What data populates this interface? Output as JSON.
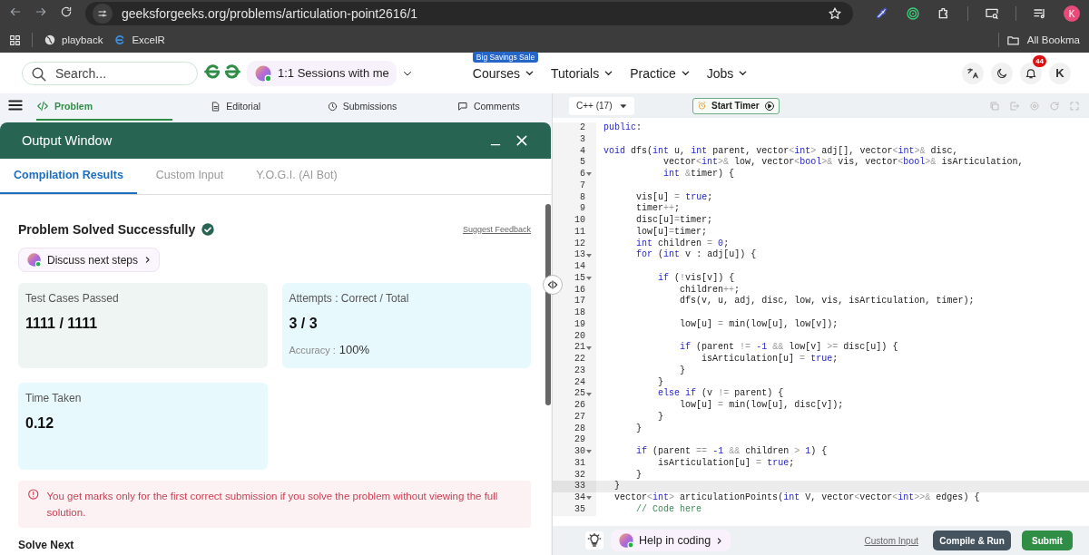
{
  "browser": {
    "url": "geeksforgeeks.org/problems/articulation-point2616/1",
    "profile": "K",
    "bookmarks": [
      "playback",
      "ExcelR"
    ],
    "all_bookmarks": "All Bookma"
  },
  "header": {
    "search": {
      "placeholder": "Search..."
    },
    "sessions": "1:1 Sessions with me",
    "sale_badge": "Big Savings Sale",
    "nav": [
      "Courses",
      "Tutorials",
      "Practice",
      "Jobs"
    ],
    "notifications": "44",
    "avatar": "K"
  },
  "problem_tabs": [
    {
      "label": "Problem",
      "selected": true
    },
    {
      "label": "Editorial",
      "selected": false
    },
    {
      "label": "Submissions",
      "selected": false
    },
    {
      "label": "Comments",
      "selected": false
    }
  ],
  "output_window": {
    "title": "Output Window",
    "tabs": [
      {
        "label": "Compilation Results",
        "selected": true
      },
      {
        "label": "Custom Input",
        "selected": false
      },
      {
        "label": "Y.O.G.I. (AI Bot)",
        "selected": false
      }
    ],
    "status": "Problem Solved Successfully",
    "feedback": "Suggest Feedback",
    "discuss": "Discuss next steps",
    "cards": [
      {
        "label": "Test Cases Passed",
        "value": "1111 / 1111",
        "color": "#eef5f3"
      },
      {
        "label": "Attempts : Correct / Total",
        "value": "3 / 3",
        "sub_label": "Accuracy :",
        "sub_value": "100%",
        "color": "#e8f9fd"
      },
      {
        "label": "Time Taken",
        "value": "0.12",
        "color": "#e8f9fd"
      }
    ],
    "notice": "You get marks only for the first correct submission if you solve the problem without viewing the full solution.",
    "next_heading": "Solve Next"
  },
  "editor": {
    "language": "C++ (17)",
    "timer": "Start Timer",
    "lines": [
      {
        "number": "2",
        "code": "public:",
        "foldable": false,
        "current": false
      },
      {
        "number": "3",
        "foldable": false,
        "current": false
      },
      {
        "number": "4",
        "code": "void dfs(int u, int parent, vector<int> adj[], vector<int>& disc,",
        "foldable": false,
        "current": false
      },
      {
        "number": "5",
        "code": "           vector<int>& low, vector<bool>& vis, vector<bool>& isArticulation,",
        "foldable": false,
        "current": false
      },
      {
        "number": "6",
        "code": "           int &timer) {",
        "foldable": true,
        "current": false
      },
      {
        "number": "7",
        "foldable": false,
        "current": false
      },
      {
        "number": "8",
        "code": "      vis[u] = true;",
        "foldable": false,
        "current": false
      },
      {
        "number": "9",
        "code": "      timer++;",
        "foldable": false,
        "current": false
      },
      {
        "number": "10",
        "code": "      disc[u]=timer;",
        "foldable": false,
        "current": false
      },
      {
        "number": "11",
        "code": "      low[u]=timer;",
        "foldable": false,
        "current": false
      },
      {
        "number": "12",
        "code": "      int children = 0;",
        "foldable": false,
        "current": false
      },
      {
        "number": "13",
        "code": "      for (int v : adj[u]) {",
        "foldable": true,
        "current": false
      },
      {
        "number": "14",
        "foldable": false,
        "current": false
      },
      {
        "number": "15",
        "code": "          if (!vis[v]) {",
        "foldable": true,
        "current": false
      },
      {
        "number": "16",
        "code": "              children++;",
        "foldable": false,
        "current": false
      },
      {
        "number": "17",
        "code": "              dfs(v, u, adj, disc, low, vis, isArticulation, timer);",
        "foldable": false,
        "current": false
      },
      {
        "number": "18",
        "foldable": false,
        "current": false
      },
      {
        "number": "19",
        "code": "              low[u] = min(low[u], low[v]);",
        "foldable": false,
        "current": false
      },
      {
        "number": "20",
        "foldable": false,
        "current": false
      },
      {
        "number": "21",
        "code": "              if (parent != -1 && low[v] >= disc[u]) {",
        "foldable": true,
        "current": false
      },
      {
        "number": "22",
        "code": "                  isArticulation[u] = true;",
        "foldable": false,
        "current": false
      },
      {
        "number": "23",
        "code": "              }",
        "foldable": false,
        "current": false
      },
      {
        "number": "24",
        "code": "          }",
        "foldable": false,
        "current": false
      },
      {
        "number": "25",
        "code": "          else if (v != parent) {",
        "foldable": true,
        "current": false
      },
      {
        "number": "26",
        "code": "              low[u] = min(low[u], disc[v]);",
        "foldable": false,
        "current": false
      },
      {
        "number": "27",
        "code": "          }",
        "foldable": false,
        "current": false
      },
      {
        "number": "28",
        "code": "      }",
        "foldable": false,
        "current": false
      },
      {
        "number": "29",
        "foldable": false,
        "current": false
      },
      {
        "number": "30",
        "code": "      if (parent == -1 && children > 1) {",
        "foldable": true,
        "current": false
      },
      {
        "number": "31",
        "code": "          isArticulation[u] = true;",
        "foldable": false,
        "current": false
      },
      {
        "number": "32",
        "code": "      }",
        "foldable": false,
        "current": false
      },
      {
        "number": "33",
        "code": "  }",
        "foldable": false,
        "current": true
      },
      {
        "number": "34",
        "code": "  vector<int> articulationPoints(int V, vector<vector<int>>& edges) {",
        "foldable": true,
        "current": false
      },
      {
        "number": "35",
        "code": "      // Code here",
        "foldable": false,
        "current": false
      }
    ],
    "help": "Help in coding",
    "custom_input": "Custom Input",
    "run": "Compile & Run",
    "submit": "Submit"
  }
}
